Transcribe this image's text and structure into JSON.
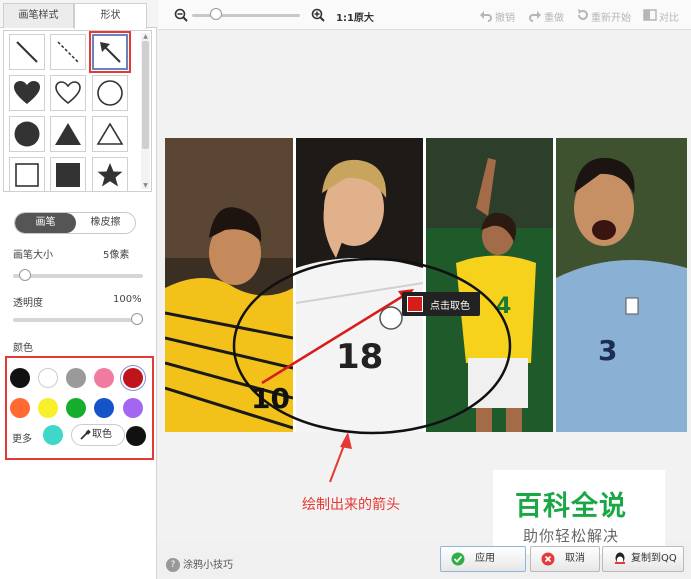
{
  "tabs": {
    "pen_style": "画笔样式",
    "shape": "形状"
  },
  "shapes": [
    "line",
    "dashed-line",
    "arrow",
    "heart-filled",
    "heart-outline",
    "circle-outline",
    "circle-filled",
    "triangle-filled",
    "triangle-outline",
    "square-outline",
    "square-filled",
    "star"
  ],
  "selected_shape": "arrow",
  "mode": {
    "pen": "画笔",
    "eraser": "橡皮擦",
    "active": "pen"
  },
  "brush_size": {
    "label": "画笔大小",
    "value": "5像素",
    "level": 0.05
  },
  "opacity": {
    "label": "透明度",
    "value": "100%",
    "level": 1.0
  },
  "color": {
    "label": "颜色",
    "swatches": [
      "#111111",
      "#ffffff",
      "#9a9a9a",
      "#f07aa0",
      "#c0141c",
      "#ff6a33",
      "#f8f02a",
      "#16ad2c",
      "#1454c8",
      "#a266f0"
    ],
    "selected": "#c0141c",
    "more_label": "更多",
    "more_swatch": "#3fd7c8",
    "picker_label": "取色",
    "current": "#111111"
  },
  "toolbar": {
    "zoom_level": 0.2,
    "actual_size_label": "1:1原大",
    "undo": "撤销",
    "redo": "重做",
    "restart": "重新开始",
    "compare": "对比"
  },
  "canvas": {
    "tooltip": "点击取色",
    "tooltip_color": "#d81b1b",
    "annotation": "绘制出来的箭头"
  },
  "watermark": {
    "title": "百科全说",
    "subtitle": "助你轻松解决"
  },
  "footer": {
    "tips": "涂鸦小技巧",
    "apply": "应用",
    "cancel": "取消",
    "copy_qq": "复制到QQ"
  }
}
